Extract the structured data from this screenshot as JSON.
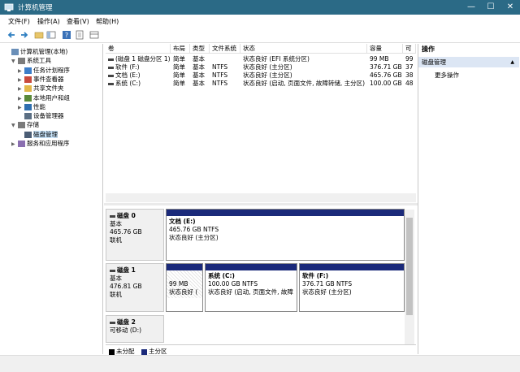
{
  "window": {
    "title": "计算机管理",
    "controls": {
      "minimize": "—",
      "maximize": "☐",
      "close": "✕"
    }
  },
  "menu": [
    "文件(F)",
    "操作(A)",
    "查看(V)",
    "帮助(H)"
  ],
  "tree": [
    {
      "label": "计算机管理(本地)",
      "level": 0,
      "arrow": "",
      "icon": "computer-icon"
    },
    {
      "label": "系统工具",
      "level": 1,
      "arrow": "▼",
      "icon": "tools-icon"
    },
    {
      "label": "任务计划程序",
      "level": 2,
      "arrow": "▶",
      "icon": "clock-icon"
    },
    {
      "label": "事件查看器",
      "level": 2,
      "arrow": "▶",
      "icon": "event-icon"
    },
    {
      "label": "共享文件夹",
      "level": 2,
      "arrow": "▶",
      "icon": "folder-icon"
    },
    {
      "label": "本地用户和组",
      "level": 2,
      "arrow": "▶",
      "icon": "users-icon"
    },
    {
      "label": "性能",
      "level": 2,
      "arrow": "▶",
      "icon": "performance-icon"
    },
    {
      "label": "设备管理器",
      "level": 2,
      "arrow": "",
      "icon": "device-icon"
    },
    {
      "label": "存储",
      "level": 1,
      "arrow": "▼",
      "icon": "storage-icon"
    },
    {
      "label": "磁盘管理",
      "level": 2,
      "arrow": "",
      "icon": "disk-icon",
      "selected": true
    },
    {
      "label": "服务和应用程序",
      "level": 1,
      "arrow": "▶",
      "icon": "services-icon"
    }
  ],
  "volumes": {
    "columns": [
      "卷",
      "布局",
      "类型",
      "文件系统",
      "状态",
      "容量",
      "可"
    ],
    "rows": [
      [
        "(磁盘 1 磁盘分区 1)",
        "简单",
        "基本",
        "",
        "状态良好 (EFI 系统分区)",
        "99 MB",
        "99"
      ],
      [
        "软件 (F:)",
        "简单",
        "基本",
        "NTFS",
        "状态良好 (主分区)",
        "376.71 GB",
        "37"
      ],
      [
        "文档 (E:)",
        "简单",
        "基本",
        "NTFS",
        "状态良好 (主分区)",
        "465.76 GB",
        "38"
      ],
      [
        "系统 (C:)",
        "简单",
        "基本",
        "NTFS",
        "状态良好 (启动, 页面文件, 故障转储, 主分区)",
        "100.00 GB",
        "48"
      ]
    ]
  },
  "disks": [
    {
      "name": "磁盘 0",
      "type": "基本",
      "size": "465.76 GB",
      "status": "联机",
      "partitions": [
        {
          "name": "文档 (E:)",
          "size": "465.76 GB NTFS",
          "status": "状态良好 (主分区)"
        }
      ]
    },
    {
      "name": "磁盘 1",
      "type": "基本",
      "size": "476.81 GB",
      "status": "联机",
      "partitions": [
        {
          "name": "",
          "size": "99 MB",
          "status": "状态良好 ("
        },
        {
          "name": "系统 (C:)",
          "size": "100.00 GB NTFS",
          "status": "状态良好 (启动, 页面文件, 故障"
        },
        {
          "name": "软件 (F:)",
          "size": "376.71 GB NTFS",
          "status": "状态良好 (主分区)"
        }
      ]
    },
    {
      "name": "磁盘 2",
      "type": "可移动 (D:)",
      "size": "",
      "status": "",
      "partitions": []
    }
  ],
  "legend": [
    {
      "label": "未分配",
      "color": "#000000"
    },
    {
      "label": "主分区",
      "color": "#1b2a7a"
    }
  ],
  "actions": {
    "header": "操作",
    "section": "磁盘管理",
    "section_arrow": "▲",
    "more": "更多操作",
    "more_arrow": "▶"
  }
}
